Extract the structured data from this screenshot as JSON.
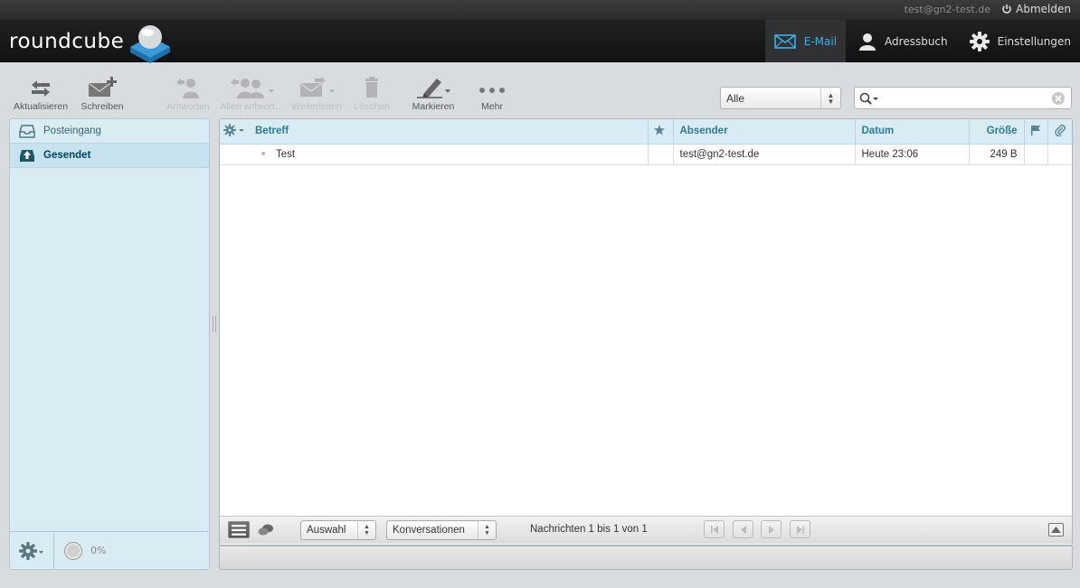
{
  "topline": {
    "user": "test@gn2-test.de",
    "logout": "Abmelden"
  },
  "logo": {
    "text": "roundcube"
  },
  "tasks": [
    {
      "label": "E-Mail",
      "icon": "mail-icon",
      "active": true
    },
    {
      "label": "Adressbuch",
      "icon": "contacts-icon",
      "active": false
    },
    {
      "label": "Einstellungen",
      "icon": "settings-icon",
      "active": false
    }
  ],
  "toolbar": {
    "refresh": "Aktualisieren",
    "compose": "Schreiben",
    "reply": "Antworten",
    "reply_all": "Allen antwort...",
    "forward": "Weiterleiten",
    "delete": "Löschen",
    "mark": "Markieren",
    "more": "Mehr"
  },
  "filter": {
    "value": "Alle"
  },
  "search": {
    "value": ""
  },
  "folders": [
    {
      "label": "Posteingang",
      "icon": "inbox-icon",
      "selected": false
    },
    {
      "label": "Gesendet",
      "icon": "sent-icon",
      "selected": true
    }
  ],
  "quota": {
    "value": "0%"
  },
  "columns": {
    "subject": "Betreff",
    "from": "Absender",
    "date": "Datum",
    "size": "Größe"
  },
  "messages": [
    {
      "subject": "Test",
      "from": "test@gn2-test.de",
      "date": "Heute 23:06",
      "size": "249 B"
    }
  ],
  "listfooter": {
    "select": "Auswahl",
    "threads": "Konversationen",
    "count": "Nachrichten 1 bis 1 von 1"
  },
  "colors": {
    "accent": "#3cb0e8",
    "folder_bg": "#d9ecf4",
    "header_text": "#2b7c95"
  }
}
